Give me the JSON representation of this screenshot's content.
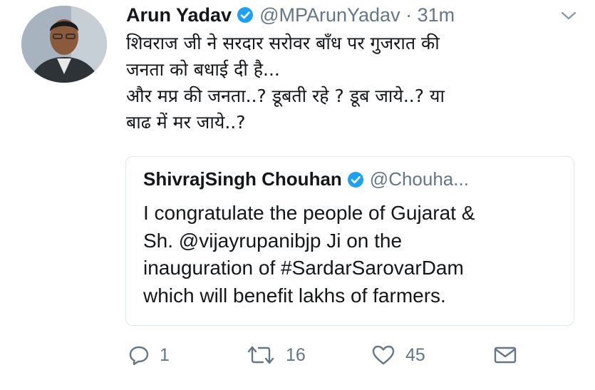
{
  "tweet": {
    "author_name": "Arun Yadav",
    "handle_time": "@MPArunYadav · 31m",
    "text_lines": [
      "शिवराज जी ने सरदार सरोवर बाँध पर गुजरात की",
      "जनता को बधाई दी है...",
      "और मप्र की जनता..? डूबती रहे ? डूब जाये..? या",
      "बाढ में मर जाये..?"
    ]
  },
  "quoted": {
    "author_name": "ShivrajSingh Chouhan",
    "handle": "@Chouha...",
    "text_lines": [
      "I congratulate the people of Gujarat &",
      "Sh. @vijayrupanibjp Ji on the",
      "inauguration of #SardarSarovarDam",
      "which will benefit lakhs of farmers."
    ]
  },
  "actions": {
    "reply_count": "1",
    "retweet_count": "16",
    "like_count": "45"
  },
  "icons": {
    "verified": "verified-badge-icon",
    "reply": "reply-icon",
    "retweet": "retweet-icon",
    "like": "heart-icon",
    "dm": "envelope-icon",
    "caret": "chevron-down-icon"
  },
  "colors": {
    "verified": "#1da1f2",
    "muted": "#657786",
    "text": "#14171a",
    "border": "#e1e8ed"
  }
}
